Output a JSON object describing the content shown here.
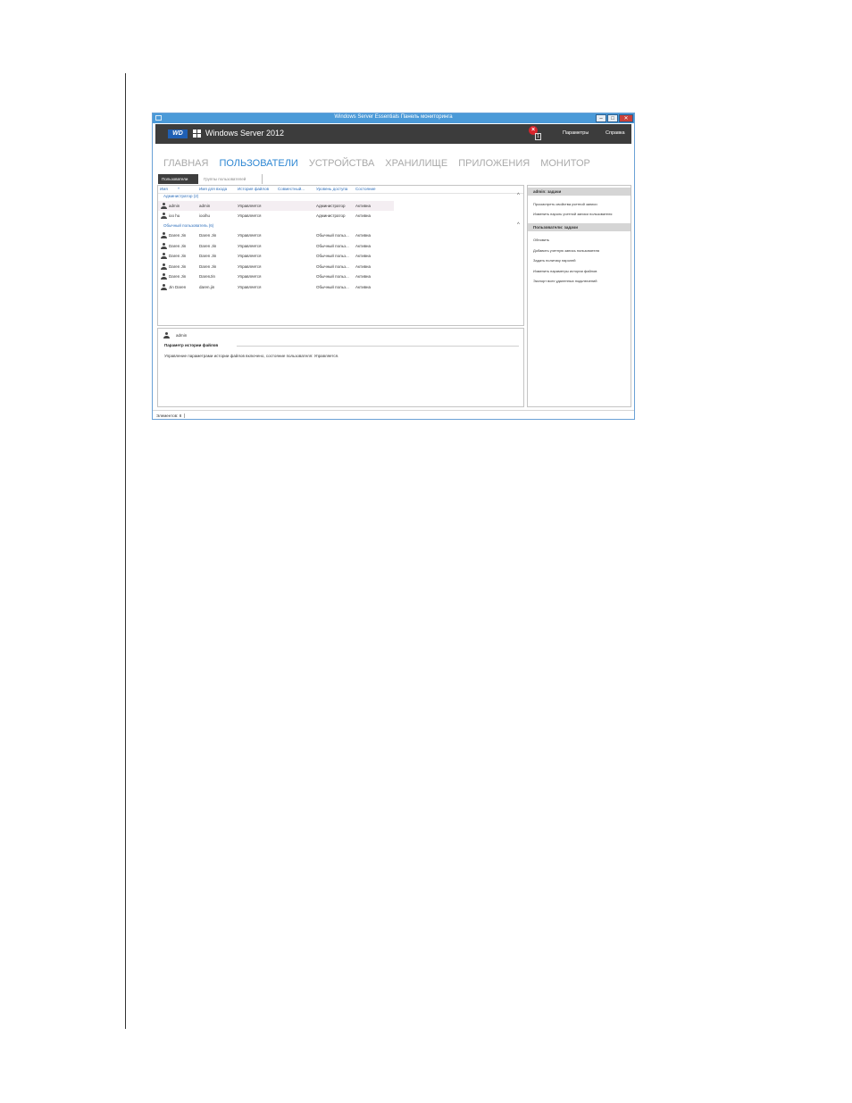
{
  "window": {
    "title": "Windows Server Essentials Панель мониторинга",
    "min_glyph": "–",
    "max_glyph": "□",
    "close_glyph": "✕"
  },
  "header": {
    "wd_logo": "WD",
    "brand": "Windows Server 2012",
    "alert_count": "1",
    "parameters": "Параметры",
    "help": "Справка"
  },
  "nav": [
    "ГЛАВНАЯ",
    "ПОЛЬЗОВАТЕЛИ",
    "УСТРОЙСТВА",
    "ХРАНИЛИЩЕ",
    "ПРИЛОЖЕНИЯ",
    "МОНИТОР"
  ],
  "subtabs": [
    "Пользователи",
    "Группы пользователей"
  ],
  "grid": {
    "columns": [
      "Имя",
      "Имя для входа",
      "История файлов",
      "Совместный...",
      "Уровень доступа",
      "Состояние"
    ],
    "sort_arrow": "^",
    "collapse_glyph": "^",
    "groups": [
      {
        "label": "Администратор (2)",
        "rows": [
          [
            "admin",
            "admin",
            "Управляется",
            "",
            "Администратор",
            "Активна"
          ],
          [
            "ioo hu",
            "iooihu",
            "Управляется",
            "",
            "Администратор",
            "Активна"
          ]
        ]
      },
      {
        "label": "Обычный пользователь (6)",
        "rows": [
          [
            "Daren Jin",
            "Daren  Jin",
            "Управляется",
            "",
            "Обычный польз...",
            "Активна"
          ],
          [
            "Daren Jin",
            "Daren  Jin",
            "Управляется",
            "",
            "Обычный польз...",
            "Активна"
          ],
          [
            "Daren Jin",
            "Daren  Jin",
            "Управляется",
            "",
            "Обычный польз...",
            "Активна"
          ],
          [
            "Daren Jin",
            "Daren Jin",
            "Управляется",
            "",
            "Обычный польз...",
            "Активна"
          ],
          [
            "Daren Jin",
            "DarenJin",
            "Управляется",
            "",
            "Обычный польз...",
            "Активна"
          ],
          [
            "Jin Daren",
            "daren.jin",
            "Управляется",
            "",
            "Обычный польз...",
            "Активна"
          ]
        ]
      }
    ]
  },
  "details": {
    "user": "admin",
    "section_title": "Параметр истории файлов",
    "text": "Управление параметрами истории файлов включено, состояние пользователя: Управляется."
  },
  "tasks": {
    "admin_header": "admin: задачи",
    "admin_items": [
      "Просмотреть свойства учетной записи",
      "Изменить пароль учетной записи пользователя"
    ],
    "users_header": "Пользователи: задачи",
    "users_items": [
      "Обновить",
      "Добавить учетную запись пользователя",
      "Задать политику паролей",
      "Изменить параметры истории файлов",
      "Экспорт всех удаленных подключений"
    ]
  },
  "status": {
    "items_label": "Элементов: 8"
  }
}
